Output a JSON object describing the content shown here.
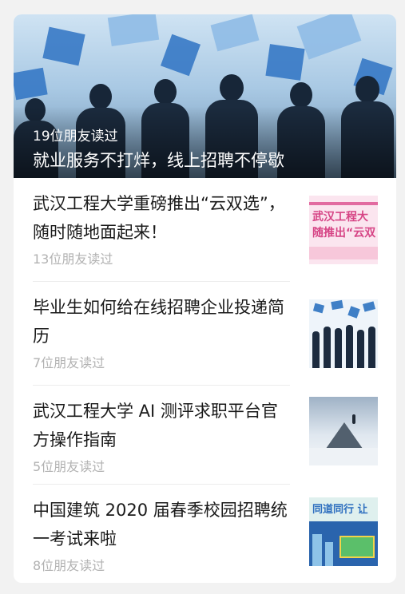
{
  "hero": {
    "readers": "19位朋友读过",
    "title": "就业服务不打烊，线上招聘不停歇"
  },
  "articles": [
    {
      "title": "武汉工程大学重磅推出“云双选”，随时随地面起来！",
      "readers": "13位朋友读过",
      "thumb_text": [
        "武汉工程大",
        "随推出“云双"
      ]
    },
    {
      "title": "毕业生如何给在线招聘企业投递简历",
      "readers": "7位朋友读过"
    },
    {
      "title": "武汉工程大学 AI 测评求职平台官方操作指南",
      "readers": "5位朋友读过"
    },
    {
      "title": "中国建筑 2020 届春季校园招聘统一考试来啦",
      "readers": "8位朋友读过",
      "thumb_text": [
        "同道同行 让"
      ]
    }
  ],
  "colors": {
    "page_bg": "#f2f2f2",
    "card_bg": "#ffffff",
    "title_text": "#1a1a1a",
    "meta_text": "#b2b2b2"
  }
}
